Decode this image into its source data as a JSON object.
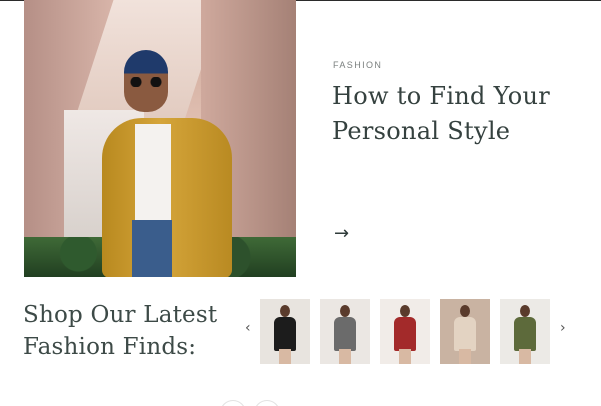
{
  "article": {
    "category": "FASHION",
    "title_line1": "How to Find Your",
    "title_line2": "Personal Style",
    "arrow": "→"
  },
  "shop": {
    "title_line1": "Shop Our Latest",
    "title_line2": "Fashion Finds:",
    "prev": "‹",
    "next": "›",
    "products": [
      {
        "bg": "#e8e4df",
        "dress": "#1c1c1c",
        "icon": "black-dress-photo"
      },
      {
        "bg": "#ebe7e3",
        "dress": "#6b6b6b",
        "icon": "gray-dress-photo"
      },
      {
        "bg": "#f1ece8",
        "dress": "#a32a2a",
        "icon": "red-sweater-photo"
      },
      {
        "bg": "#c9b3a2",
        "dress": "#e3d3c2",
        "icon": "beige-dress-photo"
      },
      {
        "bg": "#eceae6",
        "dress": "#5d6a3b",
        "icon": "olive-dress-photo"
      }
    ]
  }
}
